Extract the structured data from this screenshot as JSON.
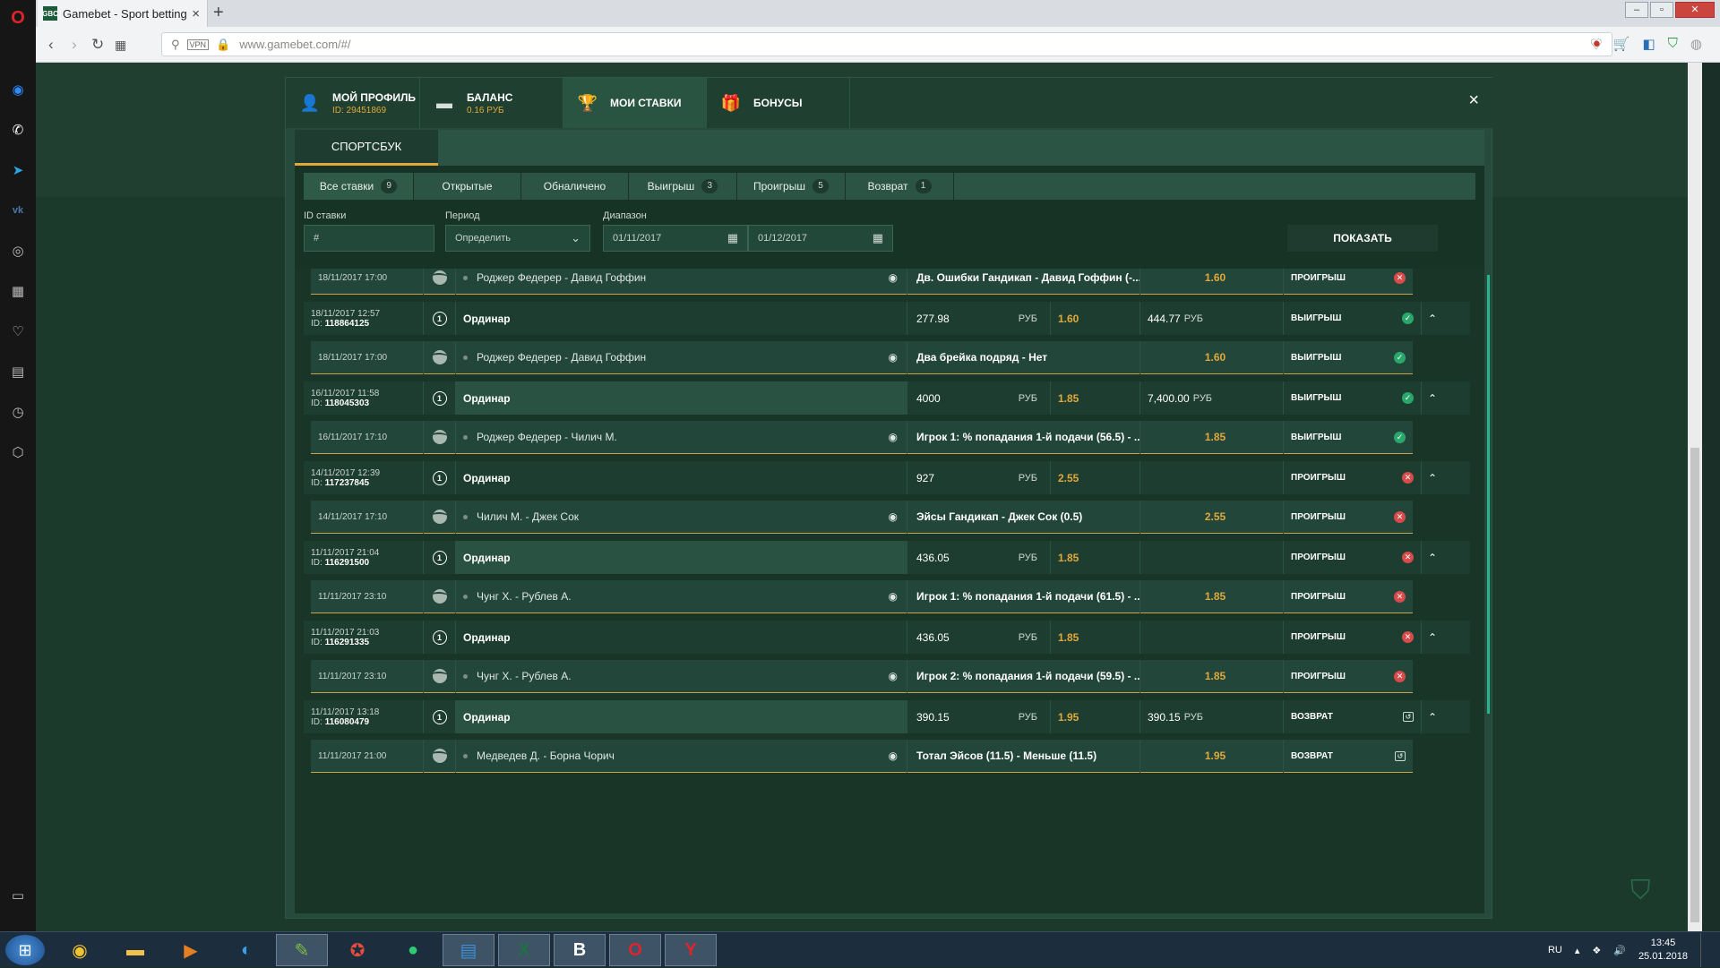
{
  "browser": {
    "tab_title": "Gamebet - Sport betting",
    "tab_favicon": "GBC",
    "url": "www.gamebet.com/#/",
    "vpn": "VPN"
  },
  "modal": {
    "tabs": [
      {
        "title": "МОЙ ПРОФИЛЬ",
        "sub": "ID: 29451869",
        "icon": "user-icon"
      },
      {
        "title": "БАЛАНС",
        "sub": "0.16 РУБ",
        "icon": "wallet-icon"
      },
      {
        "title": "МОИ СТАВКИ",
        "sub": "",
        "icon": "trophy-icon"
      },
      {
        "title": "БОНУСЫ",
        "sub": "",
        "icon": "gift-icon"
      }
    ],
    "close": "×",
    "sportsbook_tab": "СПОРТСБУК",
    "filters": {
      "tabs": [
        {
          "label": "Все ставки",
          "count": "9"
        },
        {
          "label": "Открытые",
          "count": ""
        },
        {
          "label": "Обналичено",
          "count": ""
        },
        {
          "label": "Выигрыш",
          "count": "3"
        },
        {
          "label": "Проигрыш",
          "count": "5"
        },
        {
          "label": "Возврат",
          "count": "1"
        }
      ],
      "id_label": "ID ставки",
      "id_placeholder": "#",
      "period_label": "Период",
      "period_value": "Определить",
      "range_label": "Диапазон",
      "date_from": "01/11/2017",
      "date_to": "01/12/2017",
      "show_button": "ПОКАЗАТЬ"
    }
  },
  "bets": [
    {
      "kind": "child",
      "date": "18/11/2017 17:00",
      "match": "Роджер Федерер - Давид Гоффин",
      "market": "Дв. Ошибки Гандикап - Давид Гоффин (-...",
      "odd": "1.60",
      "status": "ПРОИГРЫШ",
      "result": "lost"
    },
    {
      "kind": "parent",
      "date": "18/11/2017 12:57",
      "id_prefix": "ID:",
      "id": "118864125",
      "type": "Ординар",
      "amount": "277.98",
      "cur": "РУБ",
      "odd": "1.60",
      "win": "444.77",
      "win_cur": "РУБ",
      "status": "ВЫИГРЫШ",
      "result": "won",
      "hl": false
    },
    {
      "kind": "child",
      "date": "18/11/2017 17:00",
      "match": "Роджер Федерер - Давид Гоффин",
      "market": "Два брейка подряд - Нет",
      "odd": "1.60",
      "status": "ВЫИГРЫШ",
      "result": "won"
    },
    {
      "kind": "parent",
      "date": "16/11/2017 11:58",
      "id_prefix": "ID:",
      "id": "118045303",
      "type": "Ординар",
      "amount": "4000",
      "cur": "РУБ",
      "odd": "1.85",
      "win": "7,400.00",
      "win_cur": "РУБ",
      "status": "ВЫИГРЫШ",
      "result": "won",
      "hl": true
    },
    {
      "kind": "child",
      "date": "16/11/2017 17:10",
      "match": "Роджер Федерер - Чилич М.",
      "market": "Игрок 1: % попадания 1-й подачи (56.5) - ...",
      "odd": "1.85",
      "status": "ВЫИГРЫШ",
      "result": "won"
    },
    {
      "kind": "parent",
      "date": "14/11/2017 12:39",
      "id_prefix": "ID:",
      "id": "117237845",
      "type": "Ординар",
      "amount": "927",
      "cur": "РУБ",
      "odd": "2.55",
      "win": "",
      "win_cur": "",
      "status": "ПРОИГРЫШ",
      "result": "lost",
      "hl": false
    },
    {
      "kind": "child",
      "date": "14/11/2017 17:10",
      "match": "Чилич М. - Джек Сок",
      "market": "Эйсы Гандикап - Джек Сок (0.5)",
      "odd": "2.55",
      "status": "ПРОИГРЫШ",
      "result": "lost"
    },
    {
      "kind": "parent",
      "date": "11/11/2017 21:04",
      "id_prefix": "ID:",
      "id": "116291500",
      "type": "Ординар",
      "amount": "436.05",
      "cur": "РУБ",
      "odd": "1.85",
      "win": "",
      "win_cur": "",
      "status": "ПРОИГРЫШ",
      "result": "lost",
      "hl": true
    },
    {
      "kind": "child",
      "date": "11/11/2017 23:10",
      "match": "Чунг Х. - Рублев А.",
      "market": "Игрок 1: % попадания 1-й подачи (61.5) - ...",
      "odd": "1.85",
      "status": "ПРОИГРЫШ",
      "result": "lost"
    },
    {
      "kind": "parent",
      "date": "11/11/2017 21:03",
      "id_prefix": "ID:",
      "id": "116291335",
      "type": "Ординар",
      "amount": "436.05",
      "cur": "РУБ",
      "odd": "1.85",
      "win": "",
      "win_cur": "",
      "status": "ПРОИГРЫШ",
      "result": "lost",
      "hl": false
    },
    {
      "kind": "child",
      "date": "11/11/2017 23:10",
      "match": "Чунг Х. - Рублев А.",
      "market": "Игрок 2: % попадания 1-й подачи (59.5) - ...",
      "odd": "1.85",
      "status": "ПРОИГРЫШ",
      "result": "lost"
    },
    {
      "kind": "parent",
      "date": "11/11/2017 13:18",
      "id_prefix": "ID:",
      "id": "116080479",
      "type": "Ординар",
      "amount": "390.15",
      "cur": "РУБ",
      "odd": "1.95",
      "win": "390.15",
      "win_cur": "РУБ",
      "status": "ВОЗВРАТ",
      "result": "ret",
      "hl": true
    },
    {
      "kind": "child",
      "date": "11/11/2017 21:00",
      "match": "Медведев Д. - Борна Чорич",
      "market": "Тотал Эйсов (11.5) - Меньше (11.5)",
      "odd": "1.95",
      "status": "ВОЗВРАТ",
      "result": "ret"
    }
  ],
  "taskbar": {
    "lang": "RU",
    "time": "13:45",
    "date": "25.01.2018"
  }
}
